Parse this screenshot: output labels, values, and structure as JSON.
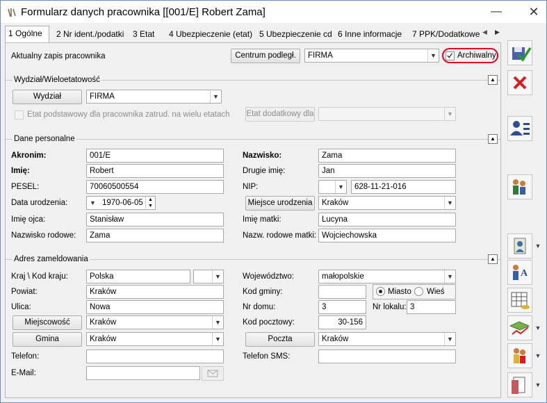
{
  "window": {
    "title": "Formularz danych pracownika [[001/E] Robert Zama]"
  },
  "tabs": [
    "1 Ogólne",
    "2 Nr ident./podatki",
    "3 Etat",
    "4 Ubezpieczenie (etat)",
    "5 Ubezpieczenie cd",
    "6 Inne informacje",
    "7 PPK/Dodatkowe"
  ],
  "top": {
    "zapis_label": "Aktualny zapis pracownika",
    "centrum_btn": "Centrum podległ.",
    "centrum_value": "FIRMA",
    "archiwalny_label": "Archiwalny"
  },
  "wydzial": {
    "section": "Wydział/Wieloetatowość",
    "btn": "Wydział",
    "value": "FIRMA",
    "etat_chk_label": "Etat podstawowy dla pracownika zatrud. na wielu etatach",
    "etat_btn": "Etat dodatkowy dla",
    "etat_value": ""
  },
  "personal": {
    "section": "Dane personalne",
    "akronim_label": "Akronim:",
    "akronim": "001/E",
    "nazwisko_label": "Nazwisko:",
    "nazwisko": "Zama",
    "imie_label": "Imię:",
    "imie": "Robert",
    "drugie_label": "Drugie imię:",
    "drugie": "Jan",
    "pesel_label": "PESEL:",
    "pesel": "70060500554",
    "nip_label": "NIP:",
    "nip_prefix": "",
    "nip": "628-11-21-016",
    "data_label": "Data urodzenia:",
    "data": "1970-06-05",
    "miejsce_btn": "Miejsce urodzenia",
    "miejsce": "Kraków",
    "ojca_label": "Imię ojca:",
    "ojca": "Stanisław",
    "matki_label": "Imię matki:",
    "matki": "Lucyna",
    "rodowe_label": "Nazwisko rodowe:",
    "rodowe": "Zama",
    "rodowe_matki_label": "Nazw. rodowe matki:",
    "rodowe_matki": "Wojciechowska"
  },
  "address": {
    "section": "Adres zameldowania",
    "kraj_label": "Kraj \\ Kod kraju:",
    "kraj": "Polska",
    "kod_kraju": "",
    "woj_label": "Województwo:",
    "woj": "małopolskie",
    "powiat_label": "Powiat:",
    "powiat": "Kraków",
    "gmina_kod_label": "Kod gminy:",
    "gmina_kod": "",
    "miasto_label": "Miasto",
    "wies_label": "Wieś",
    "ulica_label": "Ulica:",
    "ulica": "Nowa",
    "domu_label": "Nr domu:",
    "domu": "3",
    "lokalu_label": "Nr lokalu:",
    "lokalu": "3",
    "miejscowosc_btn": "Miejscowość",
    "miejscowosc": "Kraków",
    "pocztowy_label": "Kod pocztowy:",
    "pocztowy": "30-156",
    "gmina_btn": "Gmina",
    "gmina": "Kraków",
    "poczta_btn": "Poczta",
    "poczta": "Kraków",
    "telefon_label": "Telefon:",
    "telefon": "",
    "sms_label": "Telefon SMS:",
    "sms": "",
    "email_label": "E-Mail:",
    "email": ""
  },
  "colors": {
    "accent_red": "#d71d1d",
    "highlight_ring": "#e0001b"
  }
}
